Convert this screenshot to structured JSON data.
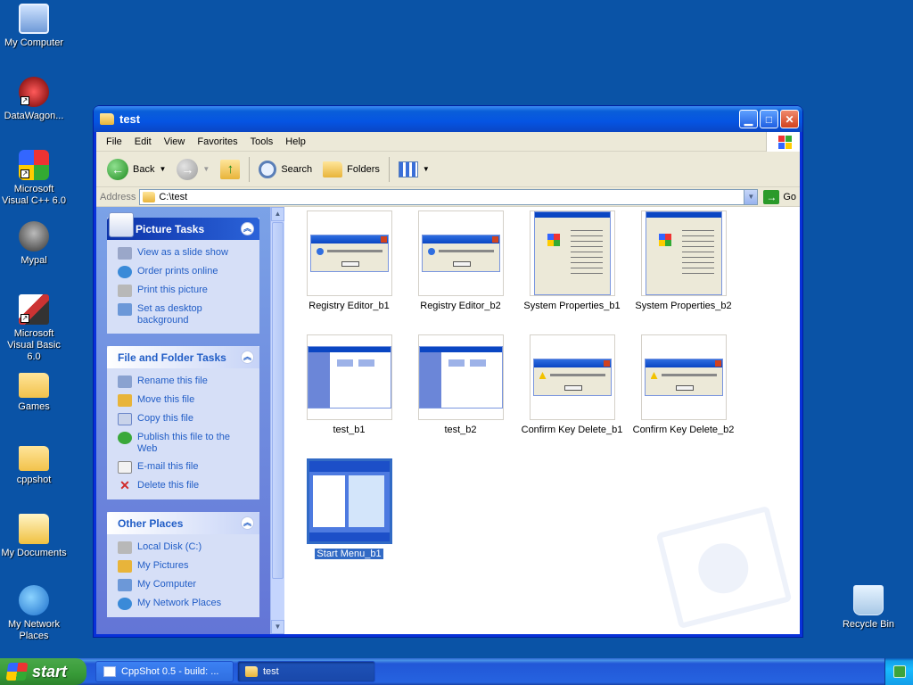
{
  "desktop": {
    "icons": [
      {
        "label": "My Computer",
        "icon": "computer-icon"
      },
      {
        "label": "DataWagon...",
        "icon": "datawagon-icon"
      },
      {
        "label": "Microsoft Visual C++ 6.0",
        "icon": "visual-cpp-icon"
      },
      {
        "label": "Mypal",
        "icon": "mypal-icon"
      },
      {
        "label": "Microsoft Visual Basic 6.0",
        "icon": "visual-basic-icon"
      },
      {
        "label": "Games",
        "icon": "folder-icon"
      },
      {
        "label": "cppshot",
        "icon": "folder-icon"
      },
      {
        "label": "My Documents",
        "icon": "my-documents-icon"
      },
      {
        "label": "My Network Places",
        "icon": "network-icon"
      },
      {
        "label": "Recycle Bin",
        "icon": "recycle-bin-icon"
      }
    ]
  },
  "window": {
    "title": "test",
    "menu": [
      "File",
      "Edit",
      "View",
      "Favorites",
      "Tools",
      "Help"
    ],
    "toolbar": {
      "back": "Back",
      "search": "Search",
      "folders": "Folders"
    },
    "address": {
      "label": "Address",
      "value": "C:\\test",
      "go": "Go"
    }
  },
  "tasks": {
    "picture": {
      "title": "Picture Tasks",
      "items": [
        "View as a slide show",
        "Order prints online",
        "Print this picture",
        "Set as desktop background"
      ]
    },
    "file_folder": {
      "title": "File and Folder Tasks",
      "items": [
        "Rename this file",
        "Move this file",
        "Copy this file",
        "Publish this file to the Web",
        "E-mail this file",
        "Delete this file"
      ]
    },
    "other": {
      "title": "Other Places",
      "items": [
        "Local Disk (C:)",
        "My Pictures",
        "My Computer",
        "My Network Places"
      ]
    }
  },
  "files": [
    {
      "name": "Registry Editor_b1",
      "kind": "dialog-info"
    },
    {
      "name": "Registry Editor_b2",
      "kind": "dialog-info"
    },
    {
      "name": "System Properties_b1",
      "kind": "props"
    },
    {
      "name": "System Properties_b2",
      "kind": "props"
    },
    {
      "name": "test_b1",
      "kind": "explorer"
    },
    {
      "name": "test_b2",
      "kind": "explorer"
    },
    {
      "name": "Confirm Key Delete_b1",
      "kind": "dialog-warn"
    },
    {
      "name": "Confirm Key Delete_b2",
      "kind": "dialog-warn"
    },
    {
      "name": "Start Menu_b1",
      "kind": "startmenu",
      "selected": true
    }
  ],
  "taskbar": {
    "start": "start",
    "buttons": [
      "CppShot 0.5 - build: ...",
      "test"
    ]
  }
}
